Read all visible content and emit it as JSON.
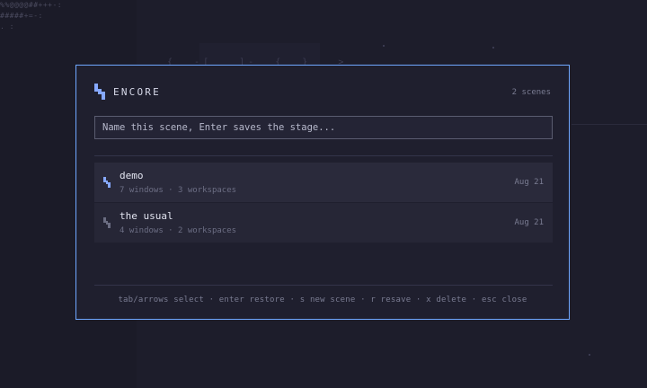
{
  "background": {
    "ascii_lines": [
      "%%@@@@##+++-:",
      "#####+=-:",
      ". :"
    ],
    "glyphs": "{  -[   ]-  {  }   > "
  },
  "modal": {
    "title": "ENCORE",
    "scene_count": "2 scenes",
    "input": {
      "placeholder": "Name this scene, Enter saves the stage...",
      "value": ""
    },
    "scenes": [
      {
        "name": "demo",
        "meta": "7 windows · 3 workspaces",
        "date": "Aug 21",
        "selected": true
      },
      {
        "name": "the usual",
        "meta": "4 windows · 2 workspaces",
        "date": "Aug 21",
        "selected": false
      }
    ],
    "footer": "tab/arrows select · enter restore · s new scene · r resave · x delete · esc close"
  },
  "colors": {
    "accent": "#6fa7ff",
    "logo": "#86a8ff",
    "icon_active": "#86a8ff",
    "icon_inactive": "#6b6d82"
  },
  "icons": {
    "logo": "encore-logo-icon",
    "scene": "scene-stack-icon"
  }
}
